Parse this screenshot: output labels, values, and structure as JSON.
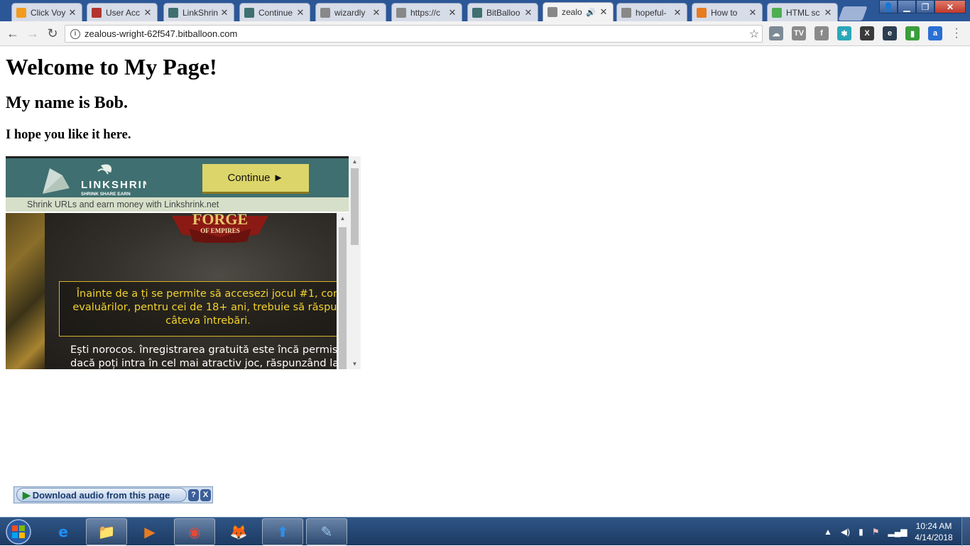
{
  "browser": {
    "tabs": [
      {
        "title": "Click Voy",
        "icon": "rss-icon",
        "color": "#f29b1d",
        "active": false
      },
      {
        "title": "User Acc",
        "icon": "dashboard-icon",
        "color": "#b3342e",
        "active": false
      },
      {
        "title": "LinkShrin",
        "icon": "linkshrink-icon",
        "color": "#3f6f70",
        "active": false
      },
      {
        "title": "Continue",
        "icon": "linkshrink-icon",
        "color": "#3f6f70",
        "active": false
      },
      {
        "title": "wizardly",
        "icon": "page-icon",
        "color": "#888888",
        "active": false
      },
      {
        "title": "https://c",
        "icon": "page-icon",
        "color": "#888888",
        "active": false
      },
      {
        "title": "BitBalloo",
        "icon": "linkshrink-icon",
        "color": "#3f6f70",
        "active": false
      },
      {
        "title": "zealo",
        "icon": "page-icon",
        "color": "#888888",
        "active": true,
        "audio": true
      },
      {
        "title": "hopeful-",
        "icon": "page-icon",
        "color": "#888888",
        "active": false
      },
      {
        "title": "How to",
        "icon": "stackoverflow-icon",
        "color": "#e87b20",
        "active": false
      },
      {
        "title": "HTML sc",
        "icon": "w3schools-icon",
        "color": "#4caf50",
        "active": false
      }
    ],
    "url": "zealous-wright-62f547.bitballoon.com",
    "extensions": [
      {
        "name": "cloud-ext-icon",
        "color": "#7d8a96",
        "glyph": "☁"
      },
      {
        "name": "tv-ext-icon",
        "color": "#8a8a8a",
        "glyph": "TV"
      },
      {
        "name": "facebook-ext-icon",
        "color": "#8a8a8a",
        "glyph": "f"
      },
      {
        "name": "gear-ext-icon",
        "color": "#2aa7b8",
        "glyph": "✱"
      },
      {
        "name": "x-ext-icon",
        "color": "#3a3a3a",
        "glyph": "X"
      },
      {
        "name": "e-ext-icon",
        "color": "#2c3e50",
        "glyph": "e"
      },
      {
        "name": "chart-ext-icon",
        "color": "#3a9e3a",
        "glyph": "▮"
      },
      {
        "name": "a-ext-icon",
        "color": "#2a6fd4",
        "glyph": "a"
      }
    ]
  },
  "page": {
    "heading": "Welcome to My Page!",
    "subheading": "My name is Bob.",
    "tagline": "I hope you like it here."
  },
  "embed": {
    "logo_text": "LINKSHRINK",
    "logo_sub": "SHRINK  SHARE  EARN",
    "continue_label": "Continue ►",
    "slogan": "Shrink URLs and earn money with Linkshrink.net",
    "ad": {
      "logo_text": "FORGE",
      "logo_sub": "OF EMPIRES",
      "box_line1": "Înainte de a ți se permite să accesezi jocul #1, con",
      "box_line2": "evaluărilor, pentru cei de 18+ ani, trebuie să răspun",
      "box_line3": "câteva întrebări.",
      "body_line1": "Ești norocos. înregistrarea gratuită este încă permisă",
      "body_line2": "dacă poți intra în cel mai atractiv joc, răspunzând la"
    }
  },
  "download_bar": {
    "label": "Download audio from this page",
    "help": "?",
    "close": "X"
  },
  "taskbar": {
    "apps": [
      {
        "name": "internet-explorer-icon",
        "open": false
      },
      {
        "name": "file-explorer-icon",
        "open": true
      },
      {
        "name": "media-player-icon",
        "open": false
      },
      {
        "name": "chrome-icon",
        "open": true
      },
      {
        "name": "firefox-icon",
        "open": false
      },
      {
        "name": "upload-app-icon",
        "open": true
      },
      {
        "name": "notepad-icon",
        "open": true
      }
    ],
    "time": "10:24 AM",
    "date": "4/14/2018"
  }
}
